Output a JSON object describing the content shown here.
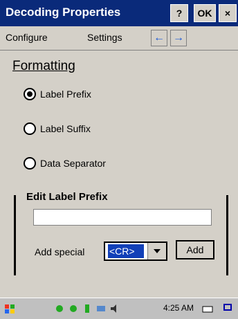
{
  "window": {
    "title": "Decoding Properties",
    "help_button": "?",
    "ok_button": "OK",
    "close_button": "×"
  },
  "menu": {
    "configure": "Configure",
    "settings": "Settings"
  },
  "formatting": {
    "heading": "Formatting",
    "options": [
      {
        "label": "Label Prefix",
        "checked": true
      },
      {
        "label": "Label Suffix",
        "checked": false
      },
      {
        "label": "Data Separator",
        "checked": false
      }
    ]
  },
  "edit_group": {
    "label": "Edit Label Prefix",
    "input_value": "",
    "add_special_label": "Add special",
    "combo_value": "<CR>",
    "add_button": "Add"
  },
  "taskbar": {
    "time": "4:25 AM"
  },
  "colors": {
    "titlebar": "#0a2a7a",
    "selection": "#1240b8",
    "face": "#d4d0c8"
  }
}
